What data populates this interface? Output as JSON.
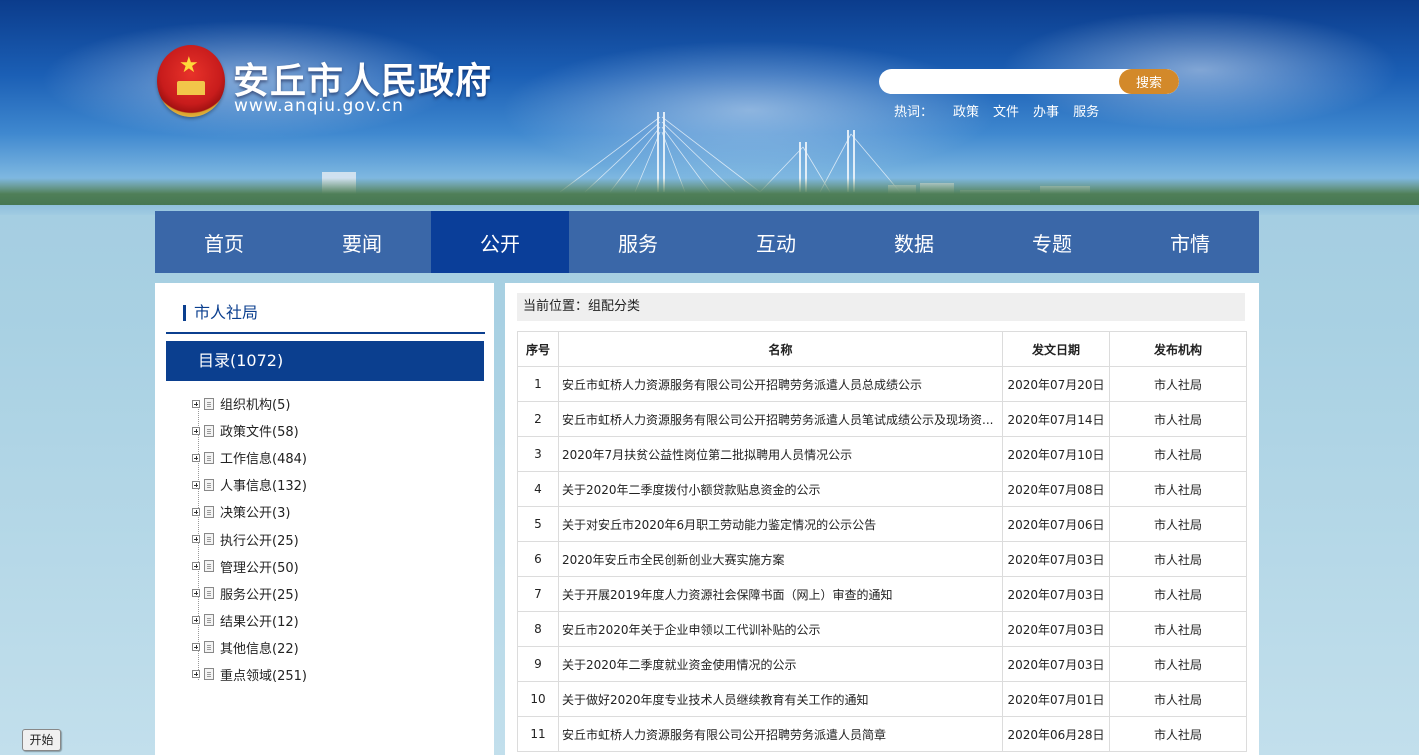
{
  "site": {
    "title": "安丘市人民政府",
    "url": "www.anqiu.gov.cn"
  },
  "search": {
    "placeholder": "",
    "button_label": "搜索"
  },
  "hotwords": {
    "label": "热词：",
    "items": [
      "政策",
      "文件",
      "办事",
      "服务"
    ]
  },
  "nav": {
    "items": [
      "首页",
      "要闻",
      "公开",
      "服务",
      "互动",
      "数据",
      "专题",
      "市情"
    ],
    "active": "公开"
  },
  "left": {
    "title": "市人社局",
    "catalog": "目录(1072)",
    "tree": [
      "组织机构(5)",
      "政策文件(58)",
      "工作信息(484)",
      "人事信息(132)",
      "决策公开(3)",
      "执行公开(25)",
      "管理公开(50)",
      "服务公开(25)",
      "结果公开(12)",
      "其他信息(22)",
      "重点领域(251)"
    ]
  },
  "breadcrumb": "当前位置：组配分类",
  "table": {
    "headers": [
      "序号",
      "名称",
      "发文日期",
      "发布机构"
    ],
    "rows": [
      [
        "1",
        "安丘市虹桥人力资源服务有限公司公开招聘劳务派遣人员总成绩公示",
        "2020年07月20日",
        "市人社局"
      ],
      [
        "2",
        "安丘市虹桥人力资源服务有限公司公开招聘劳务派遣人员笔试成绩公示及现场资...",
        "2020年07月14日",
        "市人社局"
      ],
      [
        "3",
        "2020年7月扶贫公益性岗位第二批拟聘用人员情况公示",
        "2020年07月10日",
        "市人社局"
      ],
      [
        "4",
        "关于2020年二季度拨付小额贷款贴息资金的公示",
        "2020年07月08日",
        "市人社局"
      ],
      [
        "5",
        "关于对安丘市2020年6月职工劳动能力鉴定情况的公示公告",
        "2020年07月06日",
        "市人社局"
      ],
      [
        "6",
        "2020年安丘市全民创新创业大赛实施方案",
        "2020年07月03日",
        "市人社局"
      ],
      [
        "7",
        "关于开展2019年度人力资源社会保障书面（网上）审查的通知",
        "2020年07月03日",
        "市人社局"
      ],
      [
        "8",
        "安丘市2020年关于企业申领以工代训补贴的公示",
        "2020年07月03日",
        "市人社局"
      ],
      [
        "9",
        "关于2020年二季度就业资金使用情况的公示",
        "2020年07月03日",
        "市人社局"
      ],
      [
        "10",
        "关于做好2020年度专业技术人员继续教育有关工作的通知",
        "2020年07月01日",
        "市人社局"
      ],
      [
        "11",
        "安丘市虹桥人力资源服务有限公司公开招聘劳务派遣人员简章",
        "2020年06月28日",
        "市人社局"
      ]
    ]
  },
  "taskbar": {
    "start_label": "开始"
  }
}
